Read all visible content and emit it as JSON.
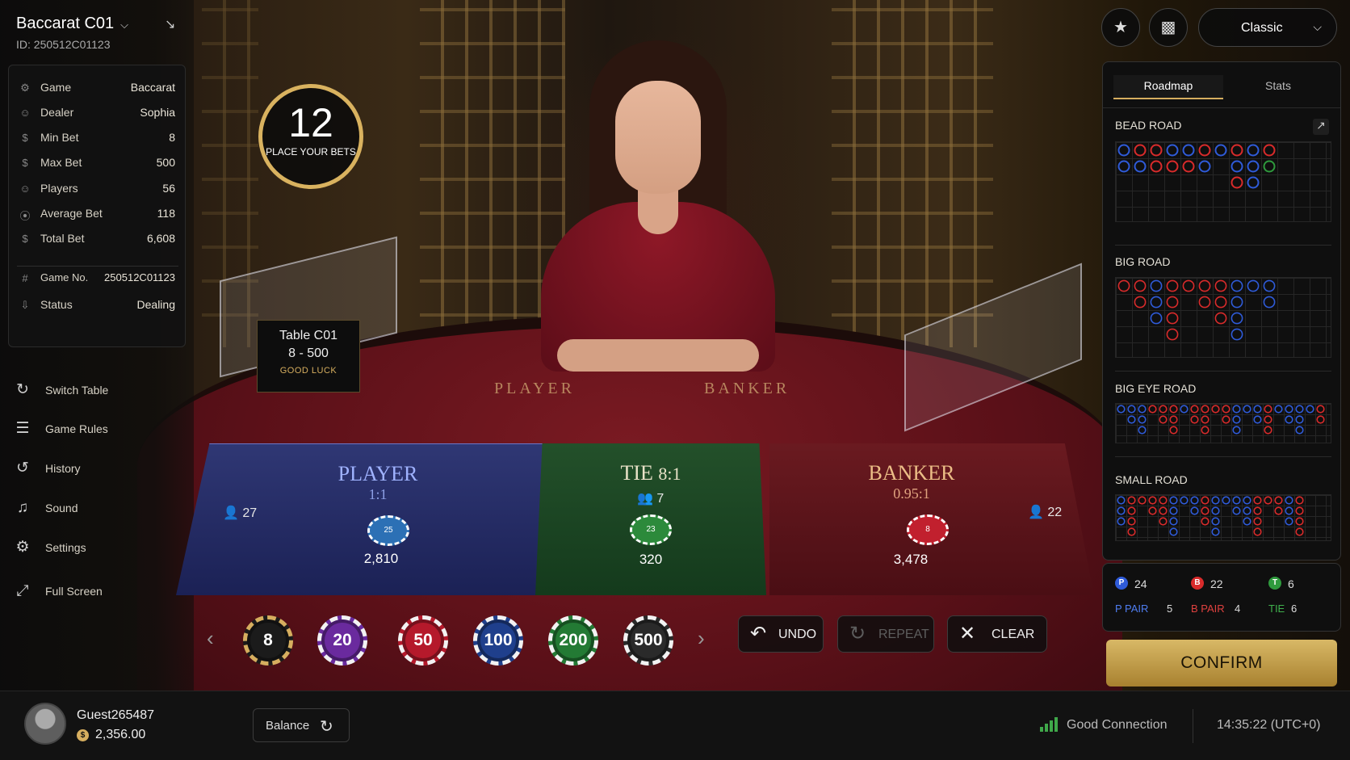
{
  "table": {
    "title": "Baccarat C01",
    "id_label": "ID: 250512C01123",
    "sign_name": "Table C01",
    "sign_limits": "8 - 500",
    "sign_msg": "GOOD LUCK"
  },
  "timer": {
    "value": "12",
    "label": "PLACE YOUR BETS"
  },
  "info": [
    {
      "icon": "game-icon",
      "key": "Game",
      "value": "Baccarat"
    },
    {
      "icon": "dealer-icon",
      "key": "Dealer",
      "value": "Sophia"
    },
    {
      "icon": "min-bet-icon",
      "key": "Min Bet",
      "value": "8"
    },
    {
      "icon": "max-bet-icon",
      "key": "Max Bet",
      "value": "500"
    },
    {
      "icon": "players-icon",
      "key": "Players",
      "value": "56"
    },
    {
      "icon": "average-bet-icon",
      "key": "Average Bet",
      "value": "118"
    },
    {
      "icon": "total-bet-icon",
      "key": "Total Bet",
      "value": "6,608"
    },
    {
      "icon": "game-number-icon",
      "key": "Game No.",
      "value": "250512C01123"
    },
    {
      "icon": "status-icon",
      "key": "Status",
      "value": "Dealing"
    }
  ],
  "menu": [
    {
      "icon": "switch-table-icon",
      "label": "Switch Table"
    },
    {
      "icon": "game-rules-icon",
      "label": "Game Rules"
    },
    {
      "icon": "history-icon",
      "label": "History"
    },
    {
      "icon": "sound-icon",
      "label": "Sound"
    },
    {
      "icon": "settings-icon",
      "label": "Settings"
    },
    {
      "icon": "full-screen-icon",
      "label": "Full Screen"
    }
  ],
  "felt": {
    "player": "PLAYER",
    "banker": "BANKER"
  },
  "bets": {
    "player": {
      "name": "PLAYER",
      "odds": "1:1",
      "players": "27",
      "chip": "25",
      "amount": "2,810"
    },
    "tie": {
      "name": "TIE",
      "odds": "8:1",
      "players": "7",
      "chip": "23",
      "amount": "320"
    },
    "banker": {
      "name": "BANKER",
      "odds": "0.95:1",
      "players": "22",
      "chip": "8",
      "amount": "3,478"
    }
  },
  "chips": [
    {
      "value": "8",
      "color": "#1b1b1b"
    },
    {
      "value": "20",
      "color": "#6a2a9e"
    },
    {
      "value": "50",
      "color": "#b5192b"
    },
    {
      "value": "100",
      "color": "#1f3f8c"
    },
    {
      "value": "200",
      "color": "#237a34"
    },
    {
      "value": "500",
      "color": "#2a2a2a"
    }
  ],
  "controls": {
    "undo": "UNDO",
    "repeat": "REPEAT",
    "clear": "CLEAR"
  },
  "right": {
    "mode": "Classic",
    "tabs": [
      "Roadmap",
      "Stats"
    ],
    "roads": [
      "BEAD ROAD",
      "BIG ROAD",
      "BIG EYE ROAD",
      "SMALL ROAD"
    ],
    "counts": {
      "p": "24",
      "b": "22",
      "t": "6"
    },
    "pairs": {
      "p": "P PAIR",
      "p_val": "5",
      "b": "B PAIR",
      "b_val": "4",
      "t": "TIE",
      "t_val": "6"
    },
    "confirm": "CONFIRM"
  },
  "colors": {
    "player": "#2f5bd9",
    "banker": "#d92b2b",
    "tie": "#2f9a3d",
    "gold": "#d6ae5f"
  },
  "bead_road": [
    [
      "P",
      "B",
      "B",
      "P",
      "P",
      "B",
      "P",
      "B",
      "P",
      "B"
    ],
    [
      "P",
      "P",
      "B",
      "B",
      "B",
      "P",
      "",
      "P",
      "P",
      "T"
    ],
    [
      "",
      "",
      "",
      "",
      "",
      "",
      "",
      "B",
      "P",
      ""
    ]
  ],
  "user": {
    "name": "Guest265487",
    "balance": "2,356.00",
    "balance_btn": "Balance"
  },
  "status": {
    "connection": "Good Connection",
    "time": "14:35:22 (UTC+0)"
  }
}
